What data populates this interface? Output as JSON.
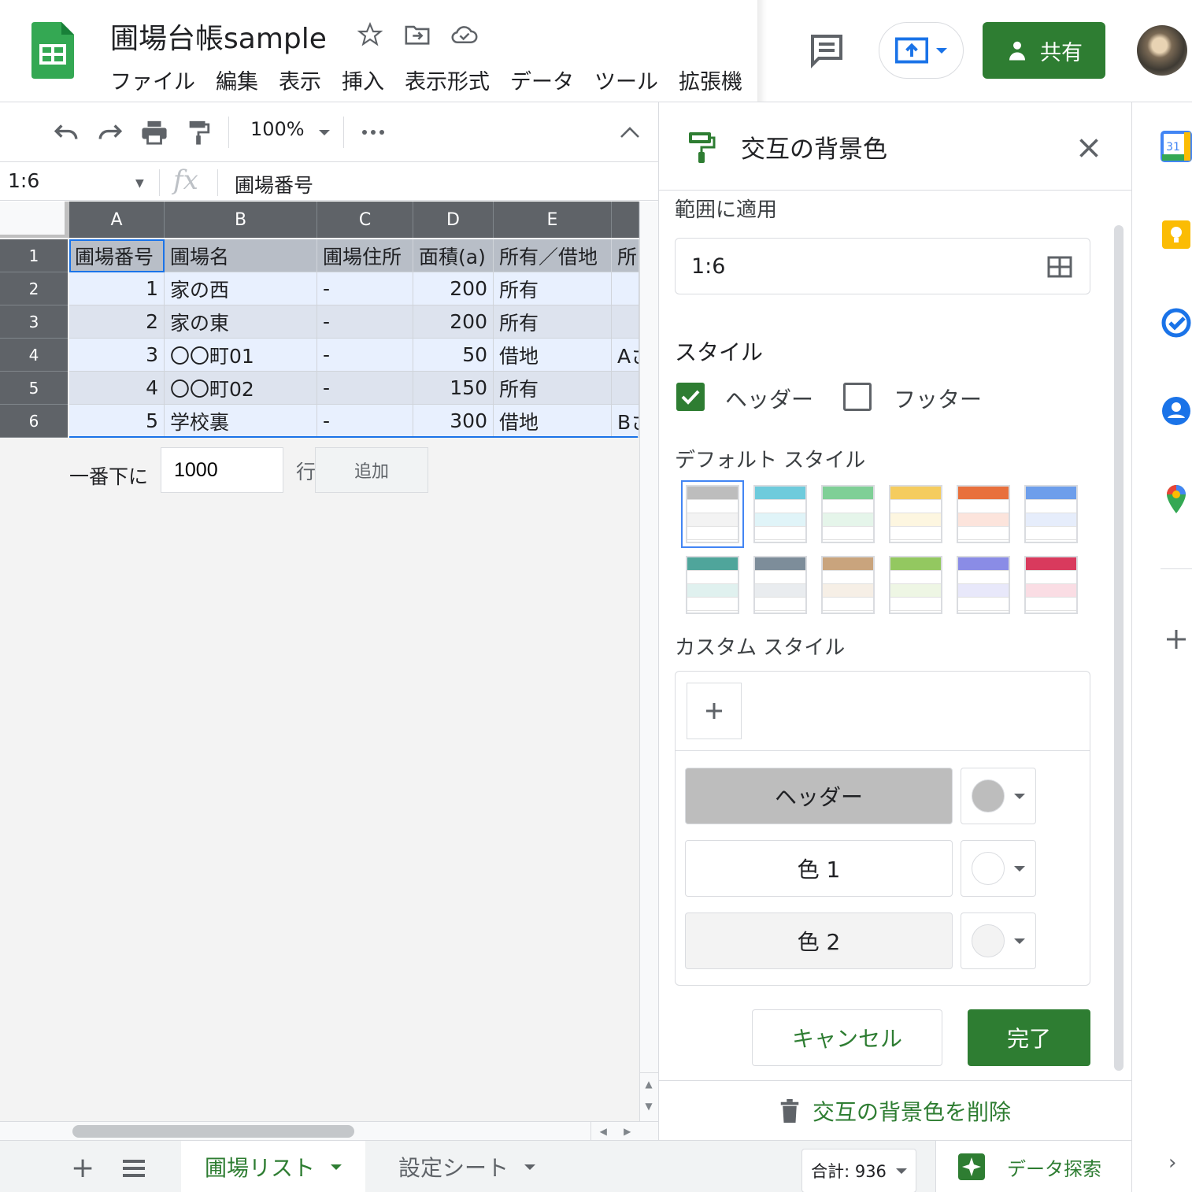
{
  "header": {
    "title": "圃場台帳sample",
    "menu": [
      "ファイル",
      "編集",
      "表示",
      "挿入",
      "表示形式",
      "データ",
      "ツール",
      "拡張機"
    ],
    "share_label": "共有",
    "icons": [
      "star-icon",
      "move-folder-icon",
      "cloud-saved-icon",
      "comment-icon",
      "present-icon",
      "person-icon"
    ]
  },
  "toolbar": {
    "zoom": "100%",
    "icons": [
      "undo-icon",
      "redo-icon",
      "print-icon",
      "paint-format-icon",
      "more-icon",
      "collapse-icon"
    ]
  },
  "formula_bar": {
    "name_box": "1:6",
    "fx": "fx",
    "formula": "圃場番号"
  },
  "grid": {
    "columns": [
      "A",
      "B",
      "C",
      "D",
      "E",
      ""
    ],
    "row_numbers": [
      "1",
      "2",
      "3",
      "4",
      "5",
      "6"
    ],
    "rows": [
      [
        "圃場番号",
        "圃場名",
        "圃場住所",
        "面積(a)",
        "所有／借地",
        "所"
      ],
      [
        "1",
        "家の西",
        "-",
        "200",
        "所有",
        ""
      ],
      [
        "2",
        "家の東",
        "-",
        "200",
        "所有",
        ""
      ],
      [
        "3",
        "〇〇町01",
        "-",
        "50",
        "借地",
        "Aさ"
      ],
      [
        "4",
        "〇〇町02",
        "-",
        "150",
        "所有",
        ""
      ],
      [
        "5",
        "学校裏",
        "-",
        "300",
        "借地",
        "Bさ"
      ]
    ],
    "add_rows": {
      "prefix": "一番下に",
      "value": "1000",
      "unit": "行",
      "button": "追加"
    }
  },
  "panel": {
    "title": "交互の背景色",
    "range_label": "範囲に適用",
    "range_value": "1:6",
    "style_label": "スタイル",
    "header_option": "ヘッダー",
    "header_checked": true,
    "footer_option": "フッター",
    "footer_checked": false,
    "default_styles_label": "デフォルト スタイル",
    "default_styles": [
      {
        "header": "#bdbdbd",
        "alt": "#f3f3f3"
      },
      {
        "header": "#6ecbdc",
        "alt": "#e0f4f8"
      },
      {
        "header": "#7fcf96",
        "alt": "#e5f5ea"
      },
      {
        "header": "#f5cc5e",
        "alt": "#fdf6e0"
      },
      {
        "header": "#e8703c",
        "alt": "#fce4dc"
      },
      {
        "header": "#6d9eeb",
        "alt": "#e6edfb"
      },
      {
        "header": "#4fa59b",
        "alt": "#e0f1ef"
      },
      {
        "header": "#7d8d9a",
        "alt": "#e9ecef"
      },
      {
        "header": "#c9a47d",
        "alt": "#f6efe6"
      },
      {
        "header": "#93c860",
        "alt": "#eef6e4"
      },
      {
        "header": "#8a8ce6",
        "alt": "#e8e8fa"
      },
      {
        "header": "#d93a5d",
        "alt": "#fadde4"
      }
    ],
    "custom_styles_label": "カスタム スタイル",
    "custom_rows": [
      {
        "label": "ヘッダー",
        "fill": "#bdbdbd",
        "dot": "#bdbdbd"
      },
      {
        "label": "色 1",
        "fill": "#ffffff",
        "dot": "#ffffff"
      },
      {
        "label": "色 2",
        "fill": "#f3f3f3",
        "dot": "#f3f3f3"
      }
    ],
    "cancel_label": "キャンセル",
    "done_label": "完了",
    "delete_label": "交互の背景色を削除"
  },
  "sheets": {
    "tabs": [
      "圃場リスト",
      "設定シート"
    ],
    "active_tab": "圃場リスト",
    "sum": "合計: 936",
    "explore": "データ探索"
  },
  "rail": {
    "calendar_day": "31",
    "icons": [
      "calendar-icon",
      "keep-icon",
      "tasks-icon",
      "contacts-icon",
      "maps-icon",
      "add-icon",
      "expand-icon"
    ]
  },
  "colors": {
    "accent_green": "#2e7d32",
    "selection_blue": "#1a73e8"
  }
}
